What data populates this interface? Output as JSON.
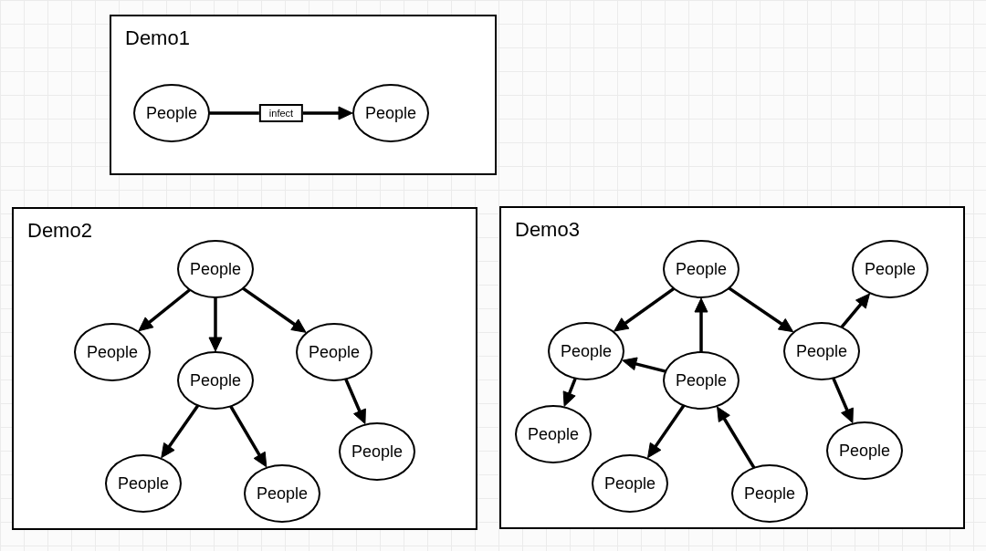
{
  "canvas": {
    "panels": [
      {
        "title": "Demo1",
        "nodes": [
          {
            "label": "People"
          },
          {
            "label": "People"
          }
        ],
        "edges": [
          {
            "label": "infect"
          }
        ]
      },
      {
        "title": "Demo2",
        "nodes": [
          {
            "label": "People"
          },
          {
            "label": "People"
          },
          {
            "label": "People"
          },
          {
            "label": "People"
          },
          {
            "label": "People"
          },
          {
            "label": "People"
          },
          {
            "label": "People"
          }
        ]
      },
      {
        "title": "Demo3",
        "nodes": [
          {
            "label": "People"
          },
          {
            "label": "People"
          },
          {
            "label": "People"
          },
          {
            "label": "People"
          },
          {
            "label": "People"
          },
          {
            "label": "People"
          },
          {
            "label": "People"
          },
          {
            "label": "People"
          },
          {
            "label": "People"
          }
        ]
      }
    ]
  }
}
